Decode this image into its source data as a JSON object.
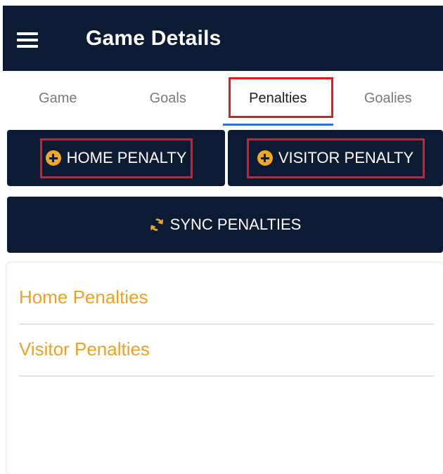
{
  "app_bar": {
    "title": "Game Details",
    "menu_icon": "hamburger-menu-icon",
    "background": "#0c1a33"
  },
  "tabs": [
    {
      "label": "Game",
      "active": false
    },
    {
      "label": "Goals",
      "active": false
    },
    {
      "label": "Penalties",
      "active": true
    },
    {
      "label": "Goalies",
      "active": false
    }
  ],
  "actions": {
    "home_penalty": {
      "label": "HOME PENALTY",
      "icon": "plus-circle-icon"
    },
    "visitor_penalty": {
      "label": "VISITOR PENALTY",
      "icon": "plus-circle-icon"
    },
    "sync_penalties": {
      "label": "SYNC PENALTIES",
      "icon": "sync-icon"
    }
  },
  "sections": {
    "home": "Home Penalties",
    "visitor": "Visitor Penalties"
  },
  "colors": {
    "accent": "#f0a020",
    "highlight": "#e01b24",
    "active_tab_indicator": "#2f6fcf"
  }
}
